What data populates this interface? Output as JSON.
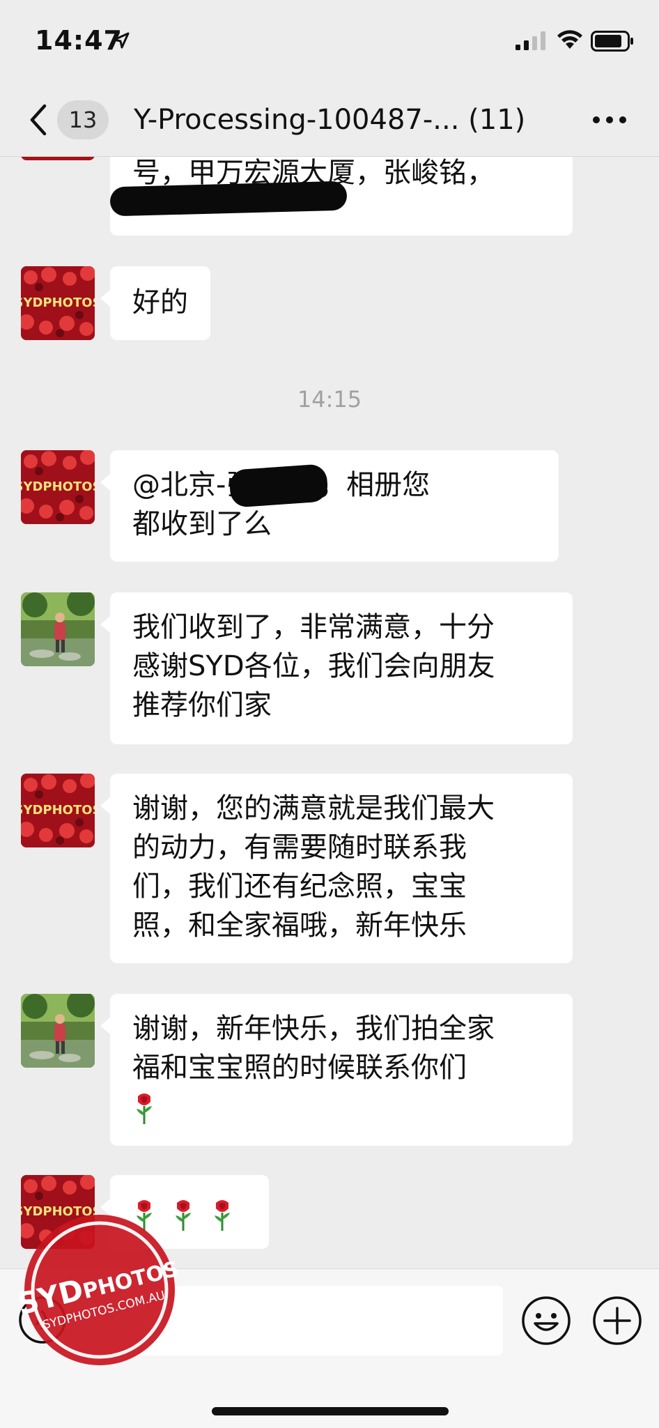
{
  "status_bar": {
    "time": "14:47"
  },
  "nav": {
    "unread_count": "13",
    "title": "Y-Processing-100487-... (11)"
  },
  "chat": {
    "partial_message": "号，甲万宏源大厦，张峻铭，",
    "messages": [
      {
        "sender": "SYDPHOTOS",
        "text": "好的"
      },
      {
        "sender": "SYDPHOTOS",
        "text": "@北京-张     您好，相册您\n都收到了么"
      },
      {
        "sender": "customer",
        "text": "我们收到了，非常满意，十分\n感谢SYD各位，我们会向朋友\n推荐你们家"
      },
      {
        "sender": "SYDPHOTOS",
        "text": "谢谢，您的满意就是我们最大\n的动力，有需要随时联系我\n们，我们还有纪念照，宝宝\n照，和全家福哦，新年快乐"
      },
      {
        "sender": "customer",
        "text": "谢谢，新年快乐，我们拍全家\n福和宝宝照的时候联系你们"
      },
      {
        "sender": "SYDPHOTOS",
        "text": ""
      }
    ],
    "timestamp": "14:15",
    "avatar_label": "SYDPHOTOS"
  },
  "watermark": {
    "brand_left": "SYD",
    "brand_right": "PHOTOS",
    "url": "SYDPHOTOS.COM.AU"
  },
  "icons": {
    "back": "chevron-left-icon",
    "more": "ellipsis-icon",
    "voice": "voice-icon",
    "emoji": "emoji-icon",
    "plus": "plus-icon",
    "rose": "rose-emoji-icon"
  },
  "colors": {
    "background": "#ededed",
    "bubble": "#ffffff",
    "timestamp": "#a0a0a0",
    "watermark_red": "#c8141e"
  }
}
